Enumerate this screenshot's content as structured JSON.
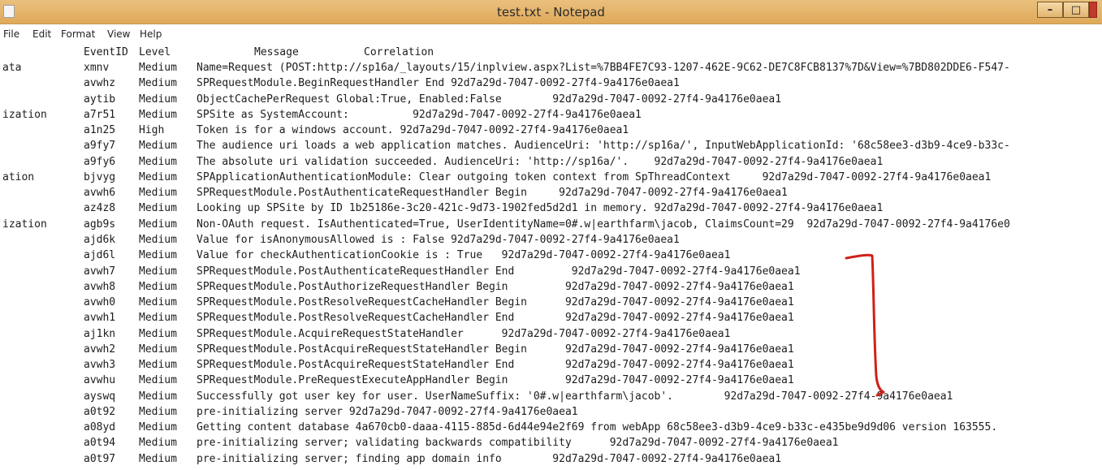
{
  "window": {
    "title": "test.txt - Notepad",
    "min_label": "–",
    "max_label": "□",
    "accent": "#e0ac5e"
  },
  "menu": [
    "File",
    "Edit",
    "Format",
    "View",
    "Help"
  ],
  "headers": {
    "eventid": "EventID",
    "level": "Level",
    "message": "Message",
    "correlation": "Correlation"
  },
  "rows": [
    {
      "cat": "ata",
      "id": "xmnv",
      "level": "Medium",
      "msg": "Name=Request (POST:http://sp16a/_layouts/15/inplview.aspx?List=%7BB4FE7C93-1207-462E-9C62-DE7C8FCB8137%7D&View=%7BD802DDE6-F547-"
    },
    {
      "cat": "",
      "id": "avwhz",
      "level": "Medium",
      "msg": "SPRequestModule.BeginRequestHandler End 92d7a29d-7047-0092-27f4-9a4176e0aea1"
    },
    {
      "cat": "",
      "id": "aytib",
      "level": "Medium",
      "msg": "ObjectCachePerRequest Global:True, Enabled:False        92d7a29d-7047-0092-27f4-9a4176e0aea1"
    },
    {
      "cat": "ization",
      "id": "a7r51",
      "level": "Medium",
      "msg": "SPSite as SystemAccount:          92d7a29d-7047-0092-27f4-9a4176e0aea1"
    },
    {
      "cat": "",
      "id": "a1n25",
      "level": "High",
      "msg": "Token is for a windows account. 92d7a29d-7047-0092-27f4-9a4176e0aea1"
    },
    {
      "cat": "",
      "id": "a9fy7",
      "level": "Medium",
      "msg": "The audience uri loads a web application matches. AudienceUri: 'http://sp16a/', InputWebApplicationId: '68c58ee3-d3b9-4ce9-b33c-"
    },
    {
      "cat": "",
      "id": "a9fy6",
      "level": "Medium",
      "msg": "The absolute uri validation succeeded. AudienceUri: 'http://sp16a/'.    92d7a29d-7047-0092-27f4-9a4176e0aea1"
    },
    {
      "cat": "ation",
      "id": "bjvyg",
      "level": "Medium",
      "msg": "SPApplicationAuthenticationModule: Clear outgoing token context from SpThreadContext     92d7a29d-7047-0092-27f4-9a4176e0aea1"
    },
    {
      "cat": "",
      "id": "avwh6",
      "level": "Medium",
      "msg": "SPRequestModule.PostAuthenticateRequestHandler Begin     92d7a29d-7047-0092-27f4-9a4176e0aea1"
    },
    {
      "cat": "",
      "id": "az4z8",
      "level": "Medium",
      "msg": "Looking up SPSite by ID 1b25186e-3c20-421c-9d73-1902fed5d2d1 in memory. 92d7a29d-7047-0092-27f4-9a4176e0aea1"
    },
    {
      "cat": "ization",
      "id": "agb9s",
      "level": "Medium",
      "msg": "Non-OAuth request. IsAuthenticated=True, UserIdentityName=0#.w|earthfarm\\jacob, ClaimsCount=29  92d7a29d-7047-0092-27f4-9a4176e0"
    },
    {
      "cat": "",
      "id": "ajd6k",
      "level": "Medium",
      "msg": "Value for isAnonymousAllowed is : False 92d7a29d-7047-0092-27f4-9a4176e0aea1"
    },
    {
      "cat": "",
      "id": "ajd6l",
      "level": "Medium",
      "msg": "Value for checkAuthenticationCookie is : True   92d7a29d-7047-0092-27f4-9a4176e0aea1"
    },
    {
      "cat": "",
      "id": "avwh7",
      "level": "Medium",
      "msg": "SPRequestModule.PostAuthenticateRequestHandler End         92d7a29d-7047-0092-27f4-9a4176e0aea1"
    },
    {
      "cat": "",
      "id": "avwh8",
      "level": "Medium",
      "msg": "SPRequestModule.PostAuthorizeRequestHandler Begin         92d7a29d-7047-0092-27f4-9a4176e0aea1"
    },
    {
      "cat": "",
      "id": "avwh0",
      "level": "Medium",
      "msg": "SPRequestModule.PostResolveRequestCacheHandler Begin      92d7a29d-7047-0092-27f4-9a4176e0aea1"
    },
    {
      "cat": "",
      "id": "avwh1",
      "level": "Medium",
      "msg": "SPRequestModule.PostResolveRequestCacheHandler End        92d7a29d-7047-0092-27f4-9a4176e0aea1"
    },
    {
      "cat": "",
      "id": "aj1kn",
      "level": "Medium",
      "msg": "SPRequestModule.AcquireRequestStateHandler      92d7a29d-7047-0092-27f4-9a4176e0aea1"
    },
    {
      "cat": "",
      "id": "avwh2",
      "level": "Medium",
      "msg": "SPRequestModule.PostAcquireRequestStateHandler Begin      92d7a29d-7047-0092-27f4-9a4176e0aea1"
    },
    {
      "cat": "",
      "id": "avwh3",
      "level": "Medium",
      "msg": "SPRequestModule.PostAcquireRequestStateHandler End        92d7a29d-7047-0092-27f4-9a4176e0aea1"
    },
    {
      "cat": "",
      "id": "avwhu",
      "level": "Medium",
      "msg": "SPRequestModule.PreRequestExecuteAppHandler Begin         92d7a29d-7047-0092-27f4-9a4176e0aea1"
    },
    {
      "cat": "",
      "id": "ayswq",
      "level": "Medium",
      "msg": "Successfully got user key for user. UserNameSuffix: '0#.w|earthfarm\\jacob'.        92d7a29d-7047-0092-27f4-9a4176e0aea1"
    },
    {
      "cat": "",
      "id": "a0t92",
      "level": "Medium",
      "msg": "pre-initializing server 92d7a29d-7047-0092-27f4-9a4176e0aea1"
    },
    {
      "cat": "",
      "id": "a08yd",
      "level": "Medium",
      "msg": "Getting content database 4a670cb0-daaa-4115-885d-6d44e94e2f69 from webApp 68c58ee3-d3b9-4ce9-b33c-e435be9d9d06 version 163555."
    },
    {
      "cat": "",
      "id": "a0t94",
      "level": "Medium",
      "msg": "pre-initializing server; validating backwards compatibility      92d7a29d-7047-0092-27f4-9a4176e0aea1"
    },
    {
      "cat": "",
      "id": "a0t97",
      "level": "Medium",
      "msg": "pre-initializing server; finding app domain info        92d7a29d-7047-0092-27f4-9a4176e0aea1"
    }
  ],
  "annotation_color": "#d0201a"
}
